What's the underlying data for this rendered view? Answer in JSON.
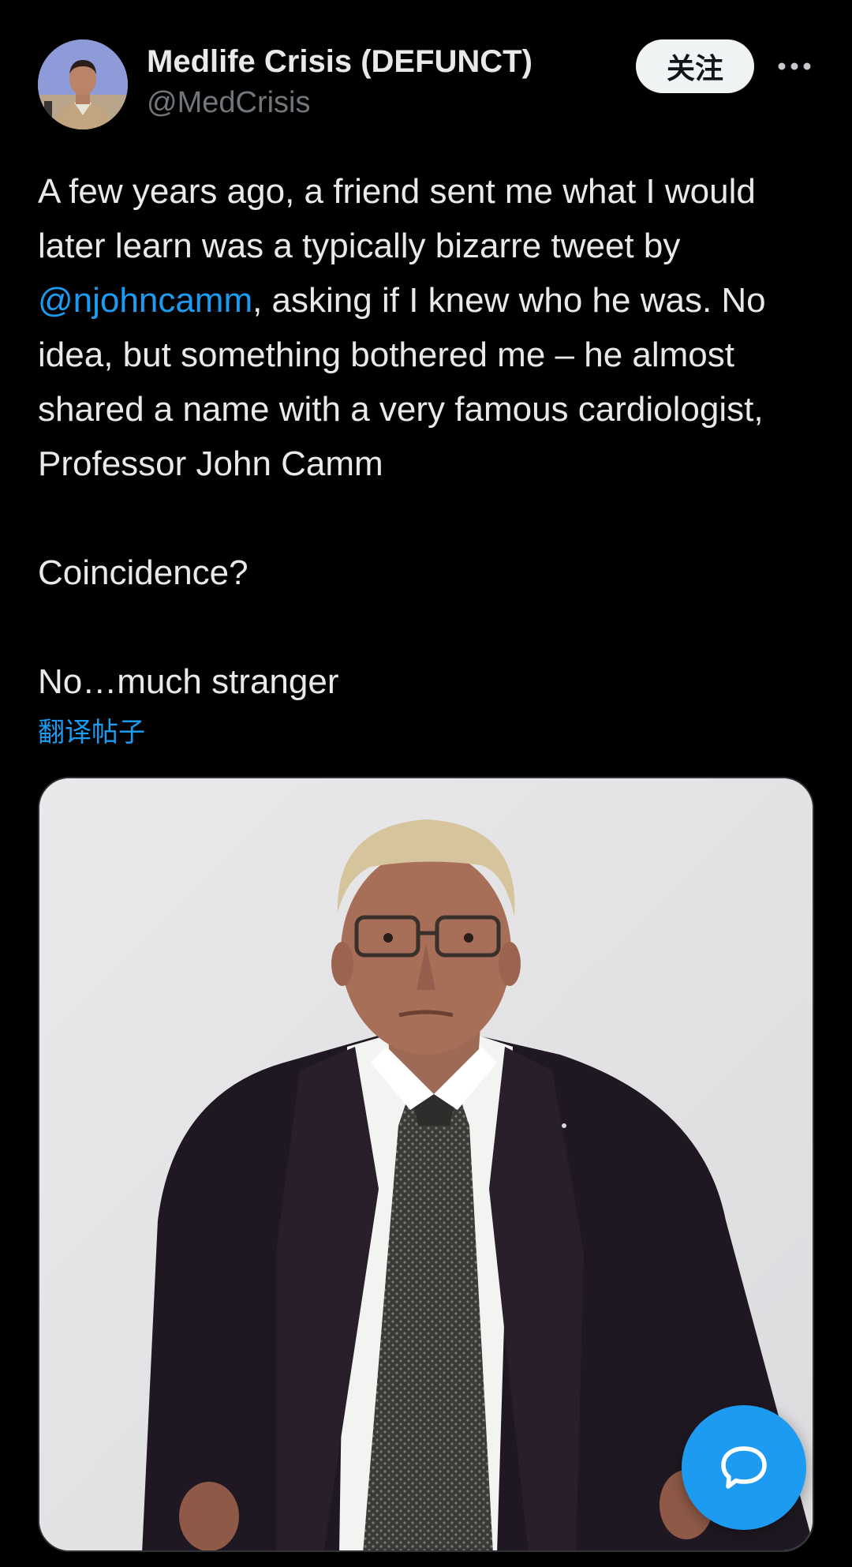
{
  "author": {
    "display_name": "Medlife Crisis (DEFUNCT)",
    "handle": "@MedCrisis",
    "avatar_icon": "profile-photo"
  },
  "actions": {
    "follow_label": "关注",
    "more_icon": "more-horizontal-icon"
  },
  "tweet": {
    "line_part1": "A few years ago, a friend sent me what I would later learn was a typically bizarre tweet by ",
    "mention": "@njohncamm",
    "line_part2": ", asking if I knew who he was. No idea, but something bothered me – he almost shared a name with a very famous cardiologist, Professor John Camm",
    "paragraph2": "Coincidence?",
    "paragraph3": "No…much stranger",
    "translate_label": "翻译帖子"
  },
  "media": {
    "type": "photo"
  },
  "fab": {
    "icon": "speech-bubble-icon"
  },
  "colors": {
    "background": "#000000",
    "accent": "#1d9bf0",
    "text_primary": "#e7e9ea",
    "text_secondary": "#71767b",
    "follow_bg": "#eff3f4"
  }
}
